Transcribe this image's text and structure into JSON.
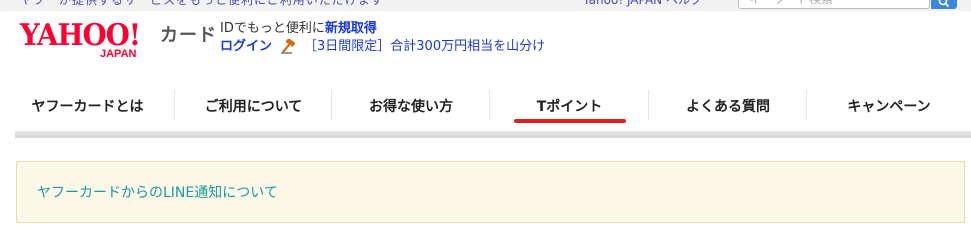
{
  "topbar": {
    "left_text": "ヤフーが提供するサービスをもっと便利にご利用いただけます",
    "right_text": "Yahoo! JAPAN ヘルプ",
    "search_placeholder": "キーワード検索"
  },
  "logo": {
    "main": "YAHOO!",
    "sub": "JAPAN",
    "card": "カード"
  },
  "account": {
    "line1_prefix": "IDでもっと便利に",
    "signup_label": "新規取得",
    "login_label": "ログイン",
    "promo_text": "［3日間限定］合計300万円相当を山分け"
  },
  "nav": {
    "items": [
      {
        "label": "ヤフーカードとは",
        "active": false
      },
      {
        "label": "ご利用について",
        "active": false
      },
      {
        "label": "お得な使い方",
        "active": false
      },
      {
        "label": "Tポイント",
        "active": true
      },
      {
        "label": "よくある質問",
        "active": false
      },
      {
        "label": "キャンペーン",
        "active": false
      }
    ],
    "active_color": "#e02020"
  },
  "notice": {
    "link_text": "ヤフーカードからのLINE通知について"
  },
  "colors": {
    "brand_red": "#ff0033",
    "link_blue": "#1a3ad6",
    "notice_link": "#1a9aa0",
    "notice_bg": "#fcf8e8",
    "search_button": "#3d87d8"
  }
}
